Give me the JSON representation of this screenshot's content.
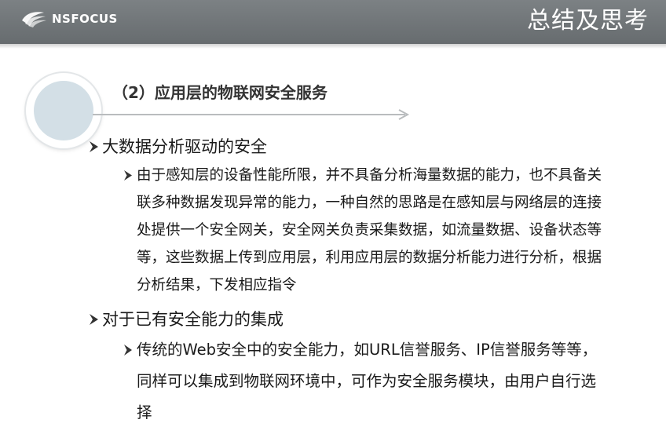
{
  "header": {
    "logo_text": "NSFOCUS",
    "title": "总结及思考"
  },
  "section": {
    "title": "（2）应用层的物联网安全服务"
  },
  "bullets": [
    {
      "text": "大数据分析驱动的安全",
      "sub": "由于感知层的设备性能所限，并不具备分析海量数据的能力，也不具备关联多种数据发现异常的能力，一种自然的思路是在感知层与网络层的连接处提供一个安全网关，安全网关负责采集数据，如流量数据、设备状态等等，这些数据上传到应用层，利用应用层的数据分析能力进行分析，根据分析结果，下发相应指令"
    },
    {
      "text": "对于已有安全能力的集成",
      "sub": "传统的Web安全中的安全能力，如URL信誉服务、IP信誉服务等等，同样可以集成到物联网环境中，可作为安全服务模块，由用户自行选择"
    }
  ],
  "colors": {
    "header_bg": "#6f7477",
    "circle_fill": "#d3dfe6",
    "text": "#1a1a1a"
  },
  "icons": {
    "bullet": "arrowhead-bullet-icon",
    "logo": "nsfocus-logo-icon"
  }
}
